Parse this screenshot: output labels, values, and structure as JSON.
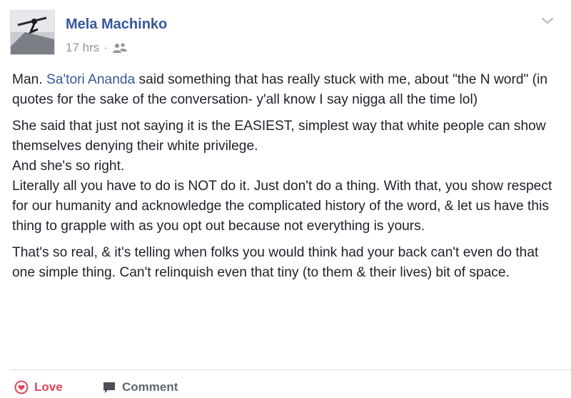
{
  "post": {
    "author": "Mela Machinko",
    "time": "17 hrs",
    "separator": "·",
    "audience_icon": "friends-icon",
    "paragraphs": {
      "p1": {
        "before": "Man. ",
        "mention": "Sa'tori Ananda",
        "after": " said something that has really stuck with me, about \"the N word\" (in quotes for the sake of the conversation- y'all know I say nigga all the time lol)"
      },
      "p2": {
        "line1": "She said that just not saying it is the EASIEST, simplest way that white people can show themselves denying their white privilege.",
        "line2": "And she's so right.",
        "line3": "Literally all you have to do is NOT do it. Just don't do a thing. With that, you show respect for our humanity and acknowledge the complicated history of the word, & let us have this thing to grapple with as you opt out because not everything is yours."
      },
      "p3": "That's so real, & it's telling when folks you would think had your back can't even do that one simple thing. Can't relinquish even that tiny (to them & their lives) bit of space."
    }
  },
  "actions": {
    "love_label": "Love",
    "comment_label": "Comment"
  },
  "icons": {
    "options": "chevron-down-icon",
    "love": "heart-outline-icon",
    "comment": "speech-bubble-icon"
  },
  "colors": {
    "link": "#365899",
    "love": "#e0475a",
    "meta": "#90949c",
    "text": "#1d2129"
  }
}
